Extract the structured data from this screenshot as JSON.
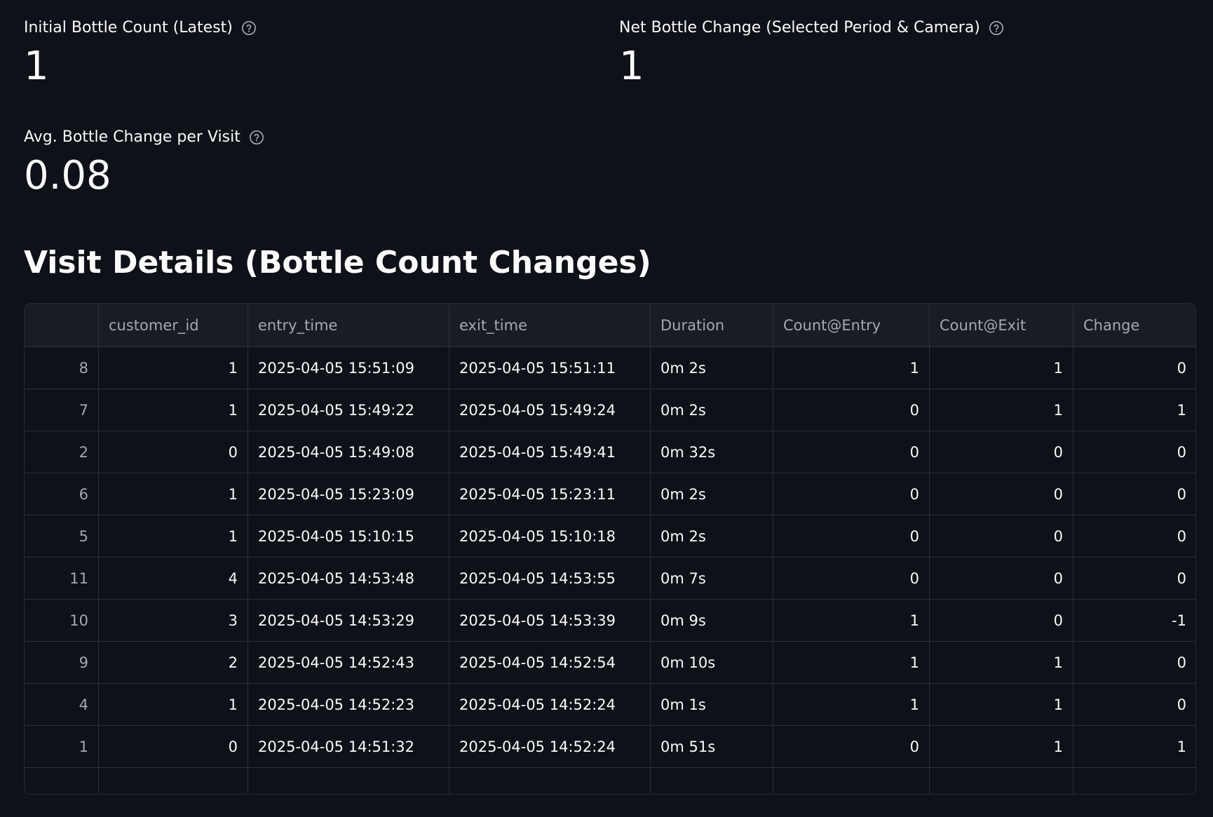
{
  "metrics": [
    {
      "label": "Initial Bottle Count (Latest)",
      "value": "1",
      "help_icon": "question-circle-icon"
    },
    {
      "label": "Net Bottle Change (Selected Period & Camera)",
      "value": "1",
      "help_icon": "question-circle-icon"
    },
    {
      "label": "Avg. Bottle Change per Visit",
      "value": "0.08",
      "help_icon": "question-circle-icon"
    }
  ],
  "section_title": "Visit Details (Bottle Count Changes)",
  "table": {
    "columns": [
      "",
      "customer_id",
      "entry_time",
      "exit_time",
      "Duration",
      "Count@Entry",
      "Count@Exit",
      "Change"
    ],
    "rows": [
      [
        "8",
        "1",
        "2025-04-05 15:51:09",
        "2025-04-05 15:51:11",
        "0m 2s",
        "1",
        "1",
        "0"
      ],
      [
        "7",
        "1",
        "2025-04-05 15:49:22",
        "2025-04-05 15:49:24",
        "0m 2s",
        "0",
        "1",
        "1"
      ],
      [
        "2",
        "0",
        "2025-04-05 15:49:08",
        "2025-04-05 15:49:41",
        "0m 32s",
        "0",
        "0",
        "0"
      ],
      [
        "6",
        "1",
        "2025-04-05 15:23:09",
        "2025-04-05 15:23:11",
        "0m 2s",
        "0",
        "0",
        "0"
      ],
      [
        "5",
        "1",
        "2025-04-05 15:10:15",
        "2025-04-05 15:10:18",
        "0m 2s",
        "0",
        "0",
        "0"
      ],
      [
        "11",
        "4",
        "2025-04-05 14:53:48",
        "2025-04-05 14:53:55",
        "0m 7s",
        "0",
        "0",
        "0"
      ],
      [
        "10",
        "3",
        "2025-04-05 14:53:29",
        "2025-04-05 14:53:39",
        "0m 9s",
        "1",
        "0",
        "-1"
      ],
      [
        "9",
        "2",
        "2025-04-05 14:52:43",
        "2025-04-05 14:52:54",
        "0m 10s",
        "1",
        "1",
        "0"
      ],
      [
        "4",
        "1",
        "2025-04-05 14:52:23",
        "2025-04-05 14:52:24",
        "0m 1s",
        "1",
        "1",
        "0"
      ],
      [
        "1",
        "0",
        "2025-04-05 14:51:32",
        "2025-04-05 14:52:24",
        "0m 51s",
        "0",
        "1",
        "1"
      ]
    ],
    "partial_row": [
      "",
      "",
      "",
      "",
      "",
      "",
      "",
      ""
    ]
  },
  "colors": {
    "background": "#0e1117",
    "header_background": "#1a1c24",
    "grid_line": "#2b2f38",
    "text": "#fafafa",
    "muted_text": "#a3a8b4"
  }
}
